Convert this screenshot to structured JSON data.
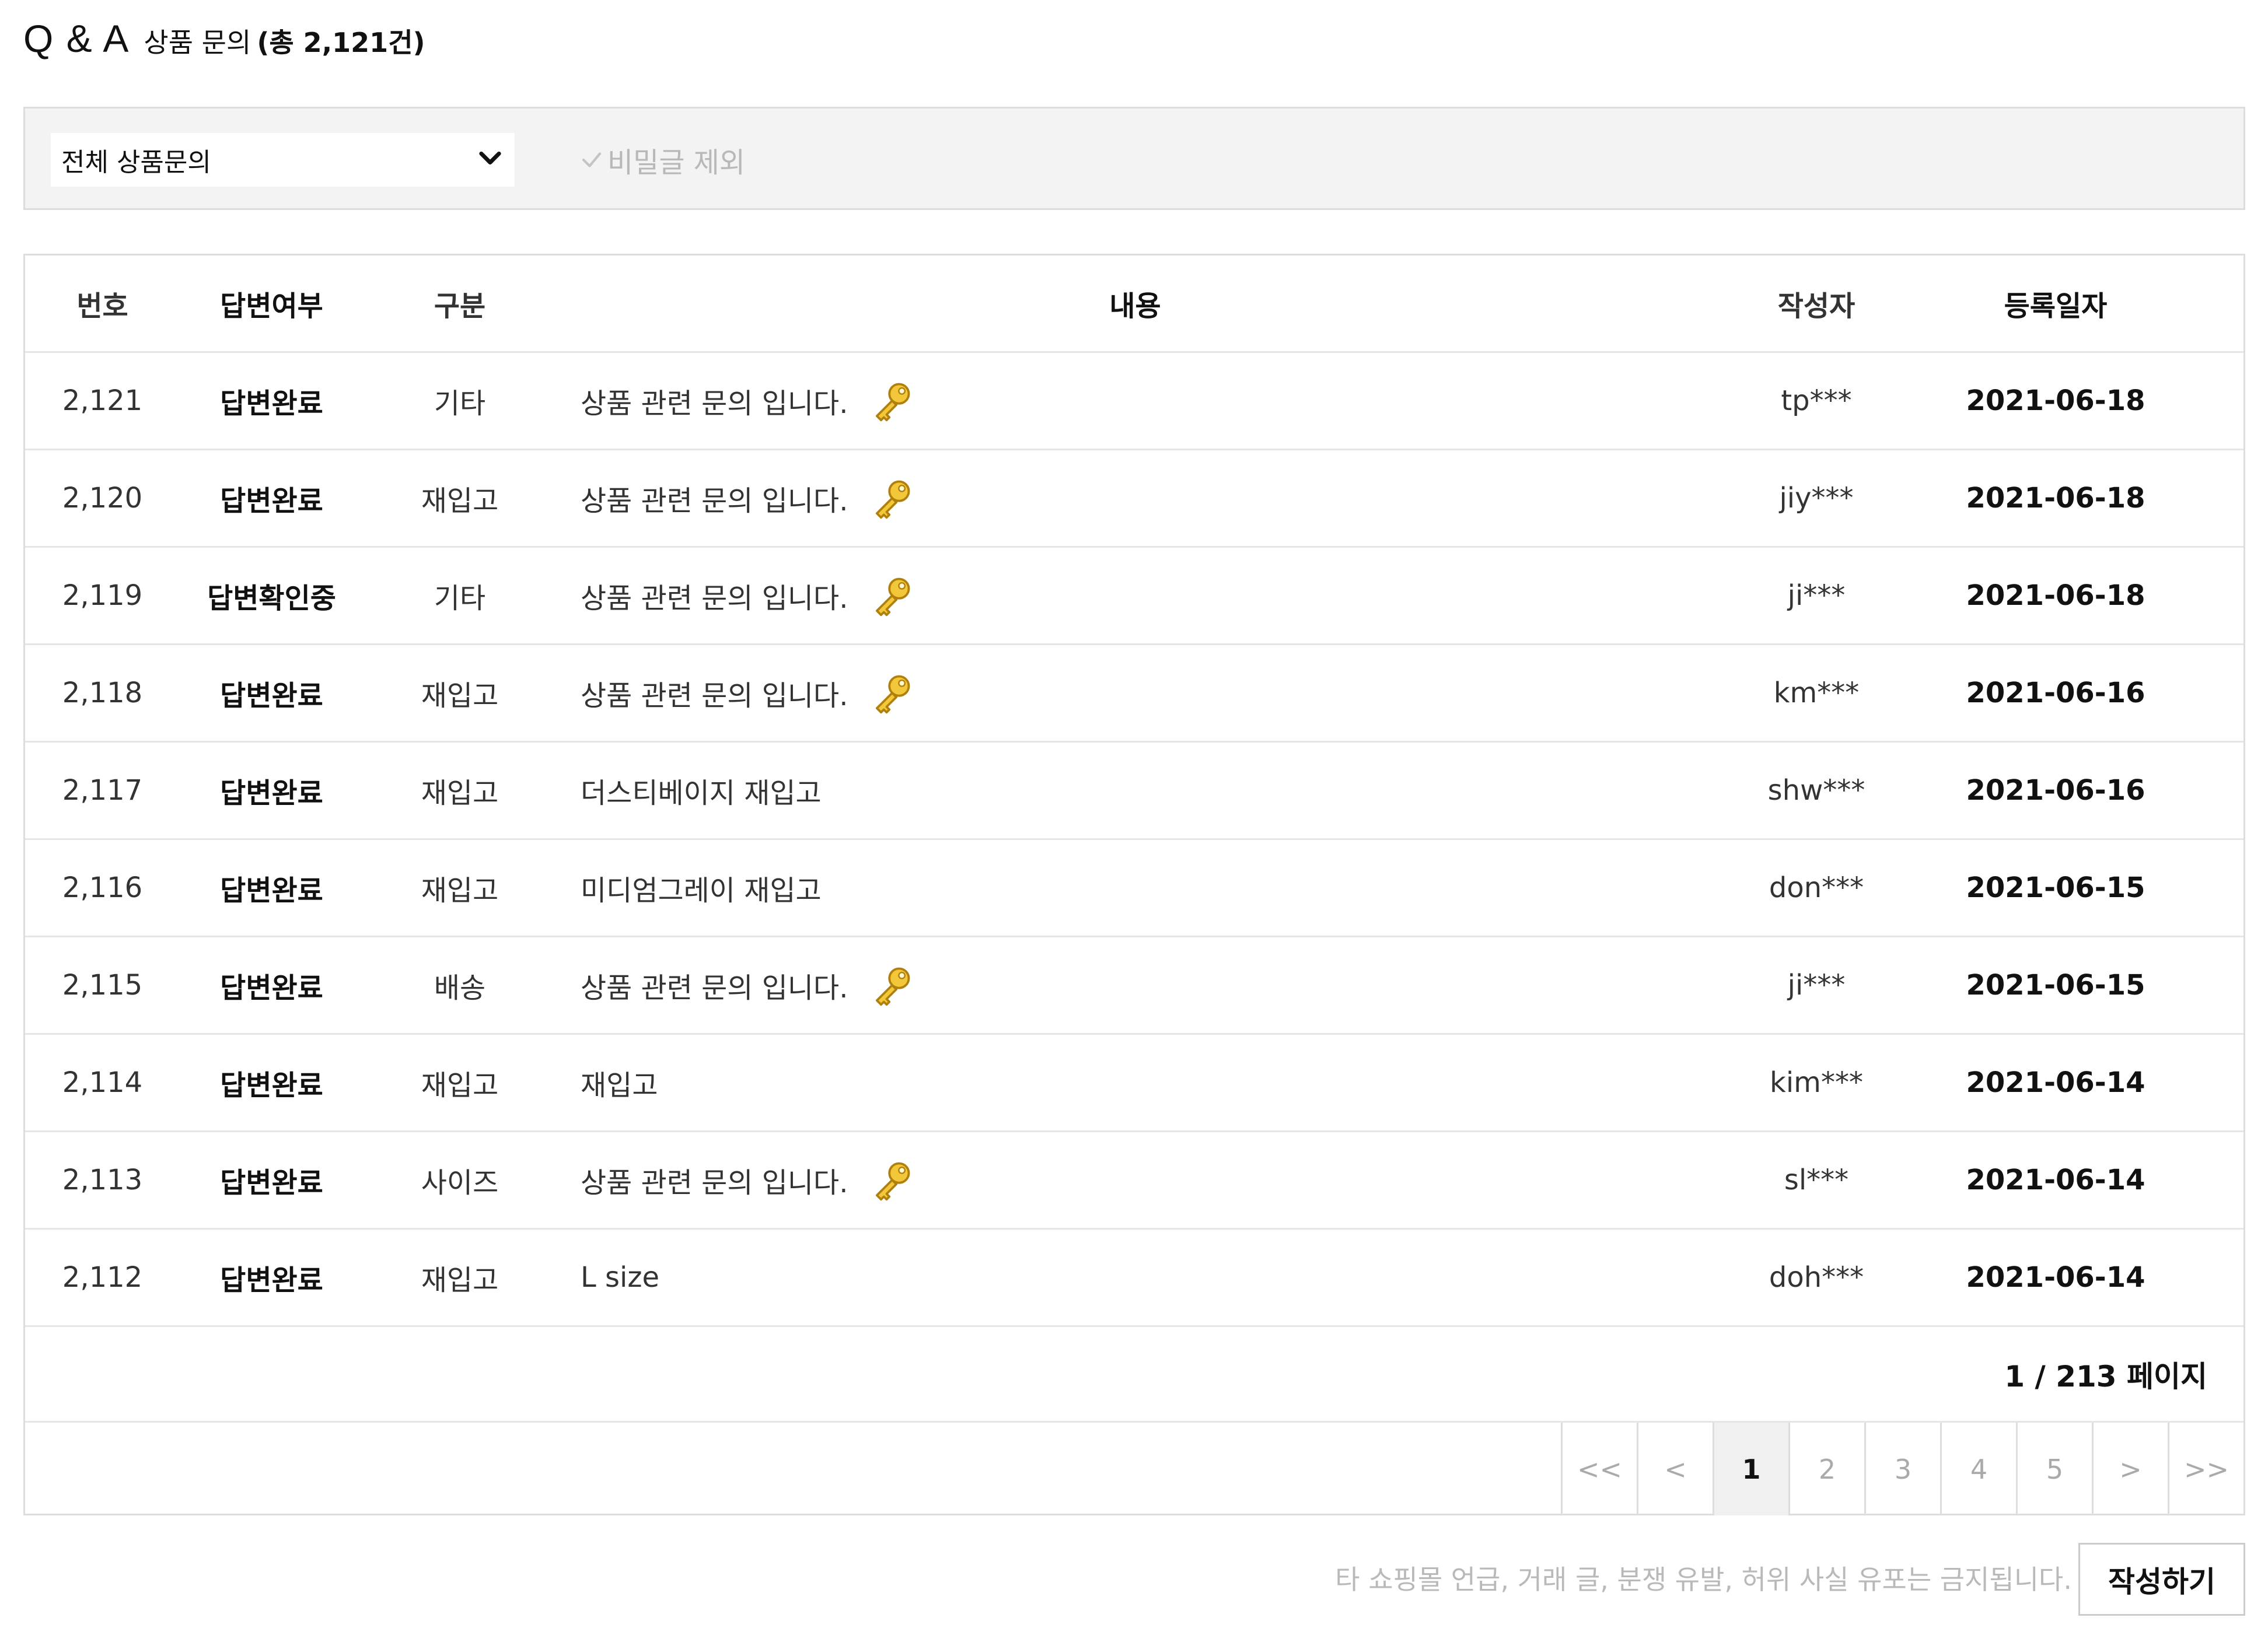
{
  "header": {
    "title": "Q & A",
    "subtitle": "상품 문의",
    "count": "(총 2,121건)"
  },
  "filter": {
    "select_value": "전체 상품문의",
    "secret_label": "비밀글 제외"
  },
  "table": {
    "headers": {
      "no": "번호",
      "status": "답변여부",
      "category": "구분",
      "content": "내용",
      "writer": "작성자",
      "date": "등록일자"
    },
    "rows": [
      {
        "no": "2,121",
        "status": "답변완료",
        "category": "기타",
        "content": "상품 관련 문의 입니다.",
        "writer": "tp***",
        "date": "2021-06-18"
      },
      {
        "no": "2,120",
        "status": "답변완료",
        "category": "재입고",
        "content": "상품 관련 문의 입니다.",
        "writer": "jiy***",
        "date": "2021-06-18"
      },
      {
        "no": "2,119",
        "status": "답변확인중",
        "category": "기타",
        "content": "상품 관련 문의 입니다.",
        "writer": "ji***",
        "date": "2021-06-18"
      },
      {
        "no": "2,118",
        "status": "답변완료",
        "category": "재입고",
        "content": "상품 관련 문의 입니다.",
        "writer": "km***",
        "date": "2021-06-16"
      },
      {
        "no": "2,117",
        "status": "답변완료",
        "category": "재입고",
        "content": "더스티베이지 재입고",
        "writer": "shw***",
        "date": "2021-06-16"
      },
      {
        "no": "2,116",
        "status": "답변완료",
        "category": "재입고",
        "content": "미디엄그레이 재입고",
        "writer": "don***",
        "date": "2021-06-15"
      },
      {
        "no": "2,115",
        "status": "답변완료",
        "category": "배송",
        "content": "상품 관련 문의 입니다.",
        "writer": "ji***",
        "date": "2021-06-15"
      },
      {
        "no": "2,114",
        "status": "답변완료",
        "category": "재입고",
        "content": "재입고",
        "writer": "kim***",
        "date": "2021-06-14"
      },
      {
        "no": "2,113",
        "status": "답변완료",
        "category": "사이즈",
        "content": "상품 관련 문의 입니다.",
        "writer": "sl***",
        "date": "2021-06-14"
      },
      {
        "no": "2,112",
        "status": "답변완료",
        "category": "재입고",
        "content": "L size",
        "writer": "doh***",
        "date": "2021-06-14"
      }
    ]
  },
  "pagination": {
    "info": "1 / 213 페이지",
    "first": "<<",
    "prev": "<",
    "pages": [
      "1",
      "2",
      "3",
      "4",
      "5"
    ],
    "next": ">",
    "last": ">>",
    "current": "1"
  },
  "footer": {
    "notice": "타 쇼핑몰 언급, 거래 글, 분쟁 유발, 허위 사실 유포는 금지됩니다.",
    "write_button": "작성하기"
  },
  "icons": {
    "secret_post": "key-icon",
    "dropdown": "chevron-down-icon",
    "filter_check": "check-icon"
  },
  "colors": {
    "key_icon": "#e1b01e",
    "filter_bg": "#f3f3f3",
    "border": "#dddddd",
    "muted_text": "#b9b9b9"
  }
}
